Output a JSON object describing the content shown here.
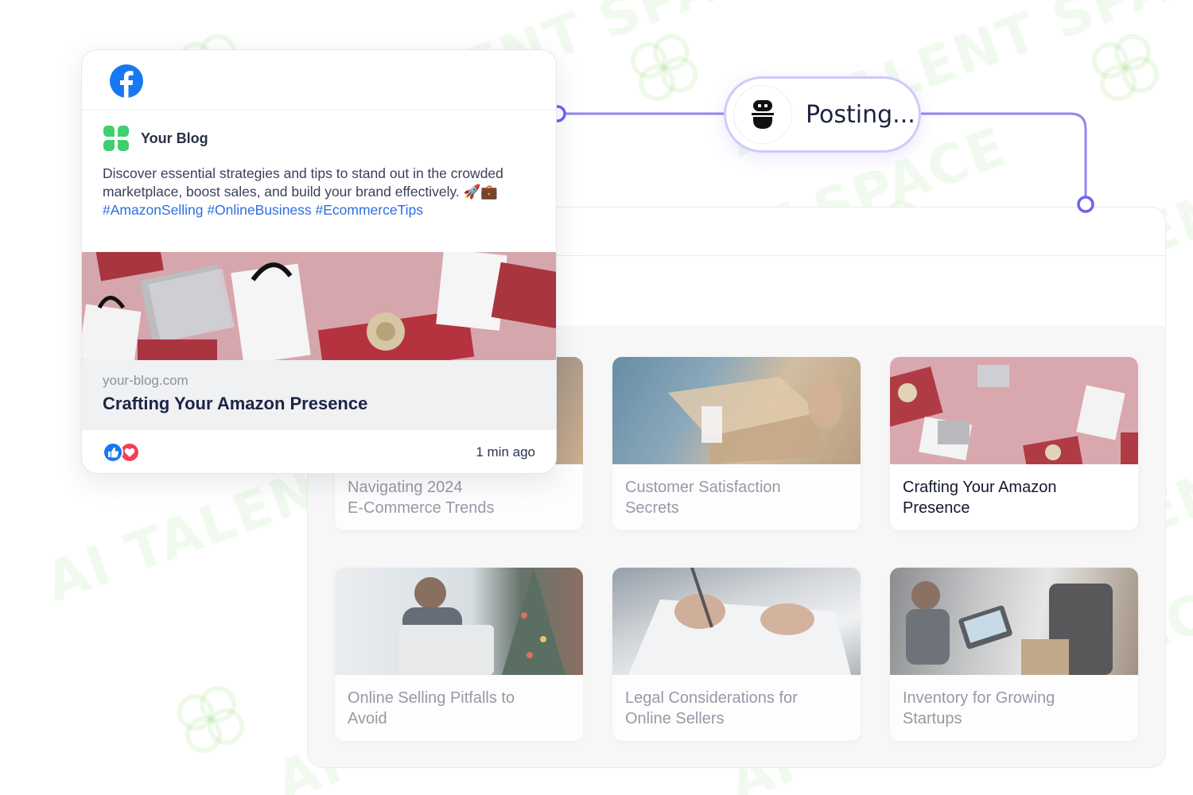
{
  "watermark": {
    "text": "AI TALENT SPACE"
  },
  "facebook_post": {
    "platform_icon": "facebook-icon",
    "author_icon": "clover-logo-icon",
    "author_name": "Your Blog",
    "body": "Discover essential strategies and tips to stand out in the crowded marketplace, boost sales, and build your brand effectively. 🚀💼",
    "hashtags": "#AmazonSelling #OnlineBusiness #EcommerceTips",
    "link_domain": "your-blog.com",
    "link_title": "Crafting Your Amazon Presence",
    "reaction_icons": [
      "like-icon",
      "love-icon"
    ],
    "timestamp": "1 min ago"
  },
  "posting_status": {
    "icon": "robot-icon",
    "label": "Posting..."
  },
  "blog_gallery": {
    "cards": [
      {
        "title": "Navigating 2024\nE-Commerce Trends",
        "active": false
      },
      {
        "title": "Customer Satisfaction\nSecrets",
        "active": false
      },
      {
        "title": "Crafting Your Amazon\nPresence",
        "active": true
      },
      {
        "title": "Online Selling Pitfalls to\nAvoid",
        "active": false
      },
      {
        "title": "Legal Considerations for\nOnline Sellers",
        "active": false
      },
      {
        "title": "Inventory for Growing\nStartups",
        "active": false
      }
    ]
  },
  "colors": {
    "accent": "#6e62f0",
    "facebook_blue": "#1877f2",
    "brand_green": "#3ecf6e",
    "hashtag_blue": "#2c6fe0"
  }
}
